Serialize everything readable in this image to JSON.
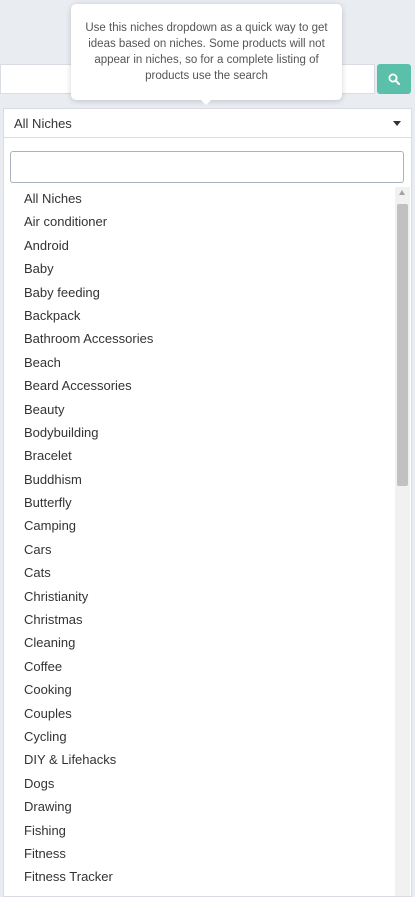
{
  "tooltip": {
    "text": "Use this niches dropdown as a quick way to get ideas based on niches. Some products will not appear in niches, so for a complete listing of products use the search"
  },
  "search": {
    "placeholder": "",
    "button_icon": "search-icon",
    "accent": "#5bc0a9"
  },
  "niche_select": {
    "selected": "All Niches"
  },
  "dropdown": {
    "filter_value": "",
    "options": [
      "All Niches",
      "Air conditioner",
      "Android",
      "Baby",
      "Baby feeding",
      "Backpack",
      "Bathroom Accessories",
      "Beach",
      "Beard Accessories",
      "Beauty",
      "Bodybuilding",
      "Bracelet",
      "Buddhism",
      "Butterfly",
      "Camping",
      "Cars",
      "Cats",
      "Christianity",
      "Christmas",
      "Cleaning",
      "Coffee",
      "Cooking",
      "Couples",
      "Cycling",
      "DIY & Lifehacks",
      "Dogs",
      "Drawing",
      "Fishing",
      "Fitness",
      "Fitness Tracker"
    ]
  }
}
